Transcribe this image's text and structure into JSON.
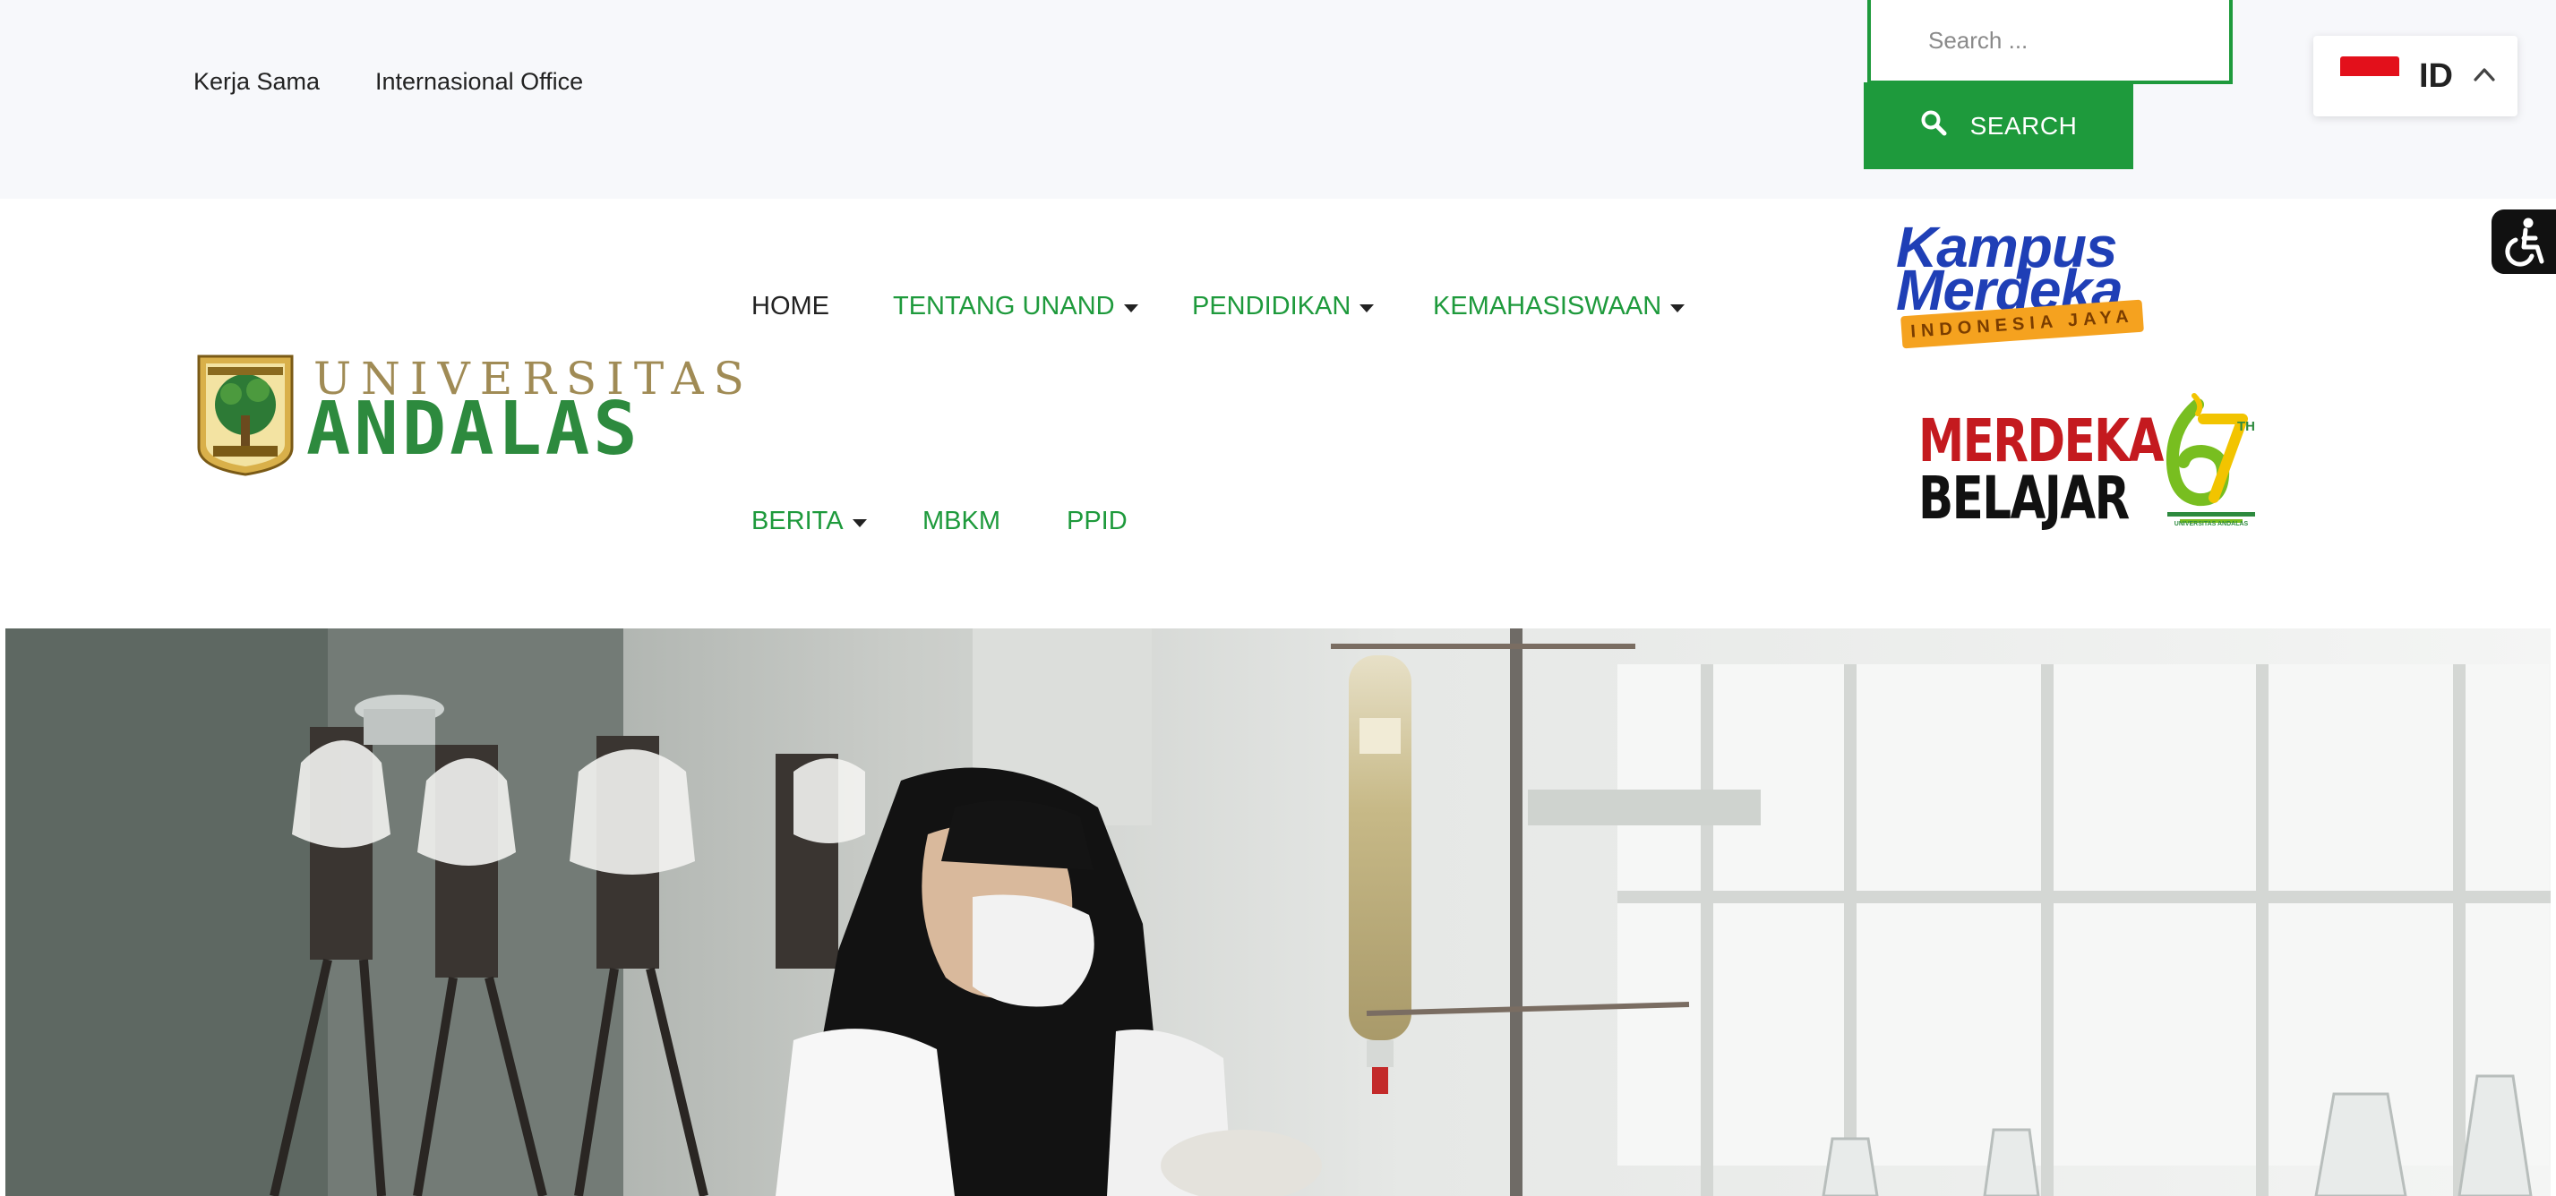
{
  "topbar": {
    "links": [
      "Kerja Sama",
      "Internasional Office"
    ],
    "search_placeholder": "Search ...",
    "search_button": "SEARCH",
    "language": {
      "code": "ID"
    }
  },
  "header": {
    "logo": {
      "line1": "UNIVERSITAS",
      "line2": "ANDALAS"
    },
    "nav": [
      "HOME",
      "TENTANG UNAND",
      "PENDIDIKAN",
      "KEMAHASISWAAN",
      "BERITA",
      "MBKM",
      "PPID"
    ],
    "badges": {
      "kampus_merdeka": {
        "line1": "Kampus",
        "line2": "Merdeka",
        "ribbon": "INDONESIA JAYA"
      },
      "merdeka_belajar": {
        "line1": "MERDEKA",
        "line2": "BELAJAR"
      },
      "anniversary": {
        "superscript": "TH",
        "caption": "UNIVERSITAS ANDALAS"
      }
    }
  },
  "colors": {
    "accent_green": "#1e9a3c",
    "topbar_bg": "#f7f8fb",
    "flag_red": "#e3101b",
    "kampus_blue": "#1f3fb6",
    "merdeka_red": "#c41a1f"
  },
  "icons": {
    "search": "search-icon",
    "language_toggle": "chevron-up-icon",
    "accessibility": "wheelchair-icon"
  }
}
